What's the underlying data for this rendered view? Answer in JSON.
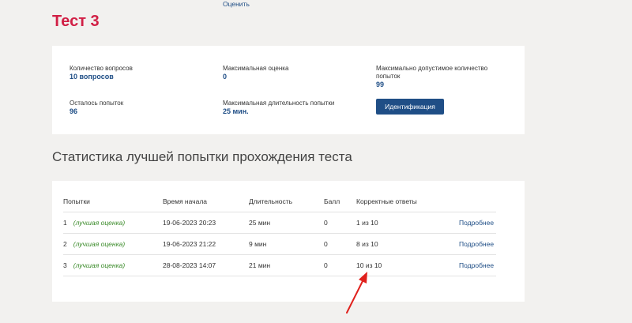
{
  "top_link": "Оценить",
  "title": "Тест 3",
  "info": {
    "questions_label": "Количество вопросов",
    "questions_value": "10 вопросов",
    "max_score_label": "Максимальная оценка",
    "max_score_value": "0",
    "max_attempts_label": "Максимально допустимое количество попыток",
    "max_attempts_value": "99",
    "remaining_label": "Осталось попыток",
    "remaining_value": "96",
    "max_duration_label": "Максимальная длительность попытки",
    "max_duration_value": "25 мин.",
    "identify_button": "Идентификация"
  },
  "section_title": "Статистика лучшей попытки прохождения теста",
  "table": {
    "headers": [
      "Попытки",
      "Время начала",
      "Длительность",
      "Балл",
      "Корректные ответы"
    ],
    "rows": [
      {
        "num": "1",
        "best": "(лучшая оценка)",
        "start": "19-06-2023 20:23",
        "duration": "25 мин",
        "score": "0",
        "correct": "1 из 10",
        "details": "Подробнее"
      },
      {
        "num": "2",
        "best": "(лучшая оценка)",
        "start": "19-06-2023 21:22",
        "duration": "9 мин",
        "score": "0",
        "correct": "8 из 10",
        "details": "Подробнее"
      },
      {
        "num": "3",
        "best": "(лучшая оценка)",
        "start": "28-08-2023 14:07",
        "duration": "21 мин",
        "score": "0",
        "correct": "10 из 10",
        "details": "Подробнее"
      }
    ]
  },
  "colors": {
    "accent": "#d11f45",
    "primary": "#1f4e86",
    "best": "#3b8b2a",
    "arrow": "#e0201c"
  }
}
